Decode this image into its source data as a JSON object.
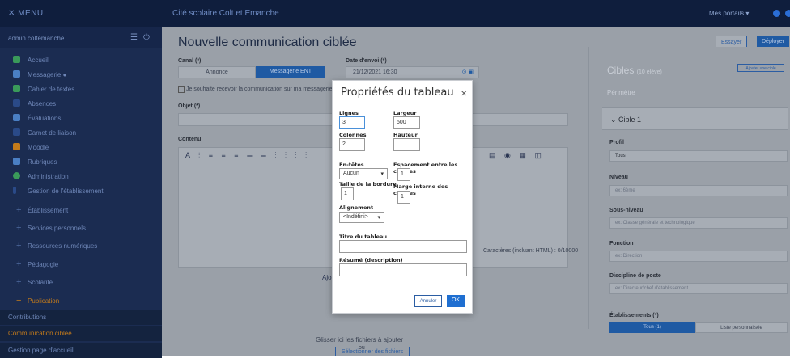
{
  "topbar": {
    "menu_label": "✕ MENU",
    "site_name": "Cité scolaire Colt et Emanche",
    "portals_label": "Mes portails ▾"
  },
  "sidebar": {
    "user": "admin coltemanche",
    "items": [
      {
        "label": "Accueil"
      },
      {
        "label": "Messagerie ●"
      },
      {
        "label": "Cahier de textes"
      },
      {
        "label": "Absences"
      },
      {
        "label": "Évaluations"
      },
      {
        "label": "Carnet de liaison"
      },
      {
        "label": "Moodle"
      },
      {
        "label": "Rubriques"
      },
      {
        "label": "Administration"
      },
      {
        "label": "Gestion de l'établissement"
      },
      {
        "label": "Établissement"
      },
      {
        "label": "Services personnels"
      },
      {
        "label": "Ressources numériques"
      },
      {
        "label": "Pédagogie"
      },
      {
        "label": "Scolarité"
      },
      {
        "label": "Publication"
      },
      {
        "label": "Contributions"
      },
      {
        "label": "Communication ciblée"
      },
      {
        "label": "Gestion page d'accueil"
      }
    ]
  },
  "page": {
    "title": "Nouvelle communication ciblée",
    "btn_enregistrer": "Essayer",
    "btn_deployer": "Déployer",
    "canal_label": "Canal (*)",
    "canal_annonce": "Annonce",
    "canal_messagerie": "Messagerie ENT",
    "date_label": "Date d'envoi (*)",
    "date_value": "21/12/2021 16:30",
    "checkbox_text": "Je souhaite recevoir la communication sur ma messagerie",
    "objet_label": "Objet (*)",
    "contenu_label": "Contenu",
    "chars_text": "Caractères (incluant HTML) : 0/10000",
    "ajout_label": "Ajo",
    "drop_text": "Glisser ici les fichiers à ajouter",
    "ou_text": "ou",
    "select_files": "Sélectionner des fichiers"
  },
  "right_panel": {
    "title": "Cibles",
    "title_count": "(10 élève)",
    "add_btn": "Ajouter une cible",
    "perimetre": "Périmètre",
    "cible1": "⌄  Cible 1",
    "profil_label": "Profil",
    "profil_value": "Tous",
    "niveau_label": "Niveau",
    "niveau_value": "ex: 6ème",
    "sousniveau_label": "Sous-niveau",
    "sousniveau_value": "ex: Classe générale et technologique",
    "fonction_label": "Fonction",
    "fonction_value": "ex: Direction",
    "discipline_label": "Discipline de poste",
    "discipline_value": "ex: Directeur/chef d'établissement",
    "etab_label": "Établissements (*)",
    "etab_tous": "Tous (1)",
    "etab_liste": "Liste personnalisée"
  },
  "dialog": {
    "title": "Propriétés du tableau",
    "lignes_label": "Lignes",
    "lignes_value": "3",
    "largeur_label": "Largeur",
    "largeur_value": "500",
    "colonnes_label": "Colonnes",
    "colonnes_value": "2",
    "hauteur_label": "Hauteur",
    "hauteur_value": "",
    "entetes_label": "En-têtes",
    "entetes_value": "Aucun",
    "espacement_label": "Espacement entre les cellules",
    "espacement_value": "1",
    "bordure_label": "Taille de la bordure",
    "bordure_value": "1",
    "marge_label": "Marge interne des cellules",
    "marge_value": "1",
    "alignement_label": "Alignement",
    "alignement_value": "<Indéfini>",
    "titre_label": "Titre du tableau",
    "resume_label": "Résumé (description)",
    "annuler": "Annuler",
    "ok": "OK"
  }
}
